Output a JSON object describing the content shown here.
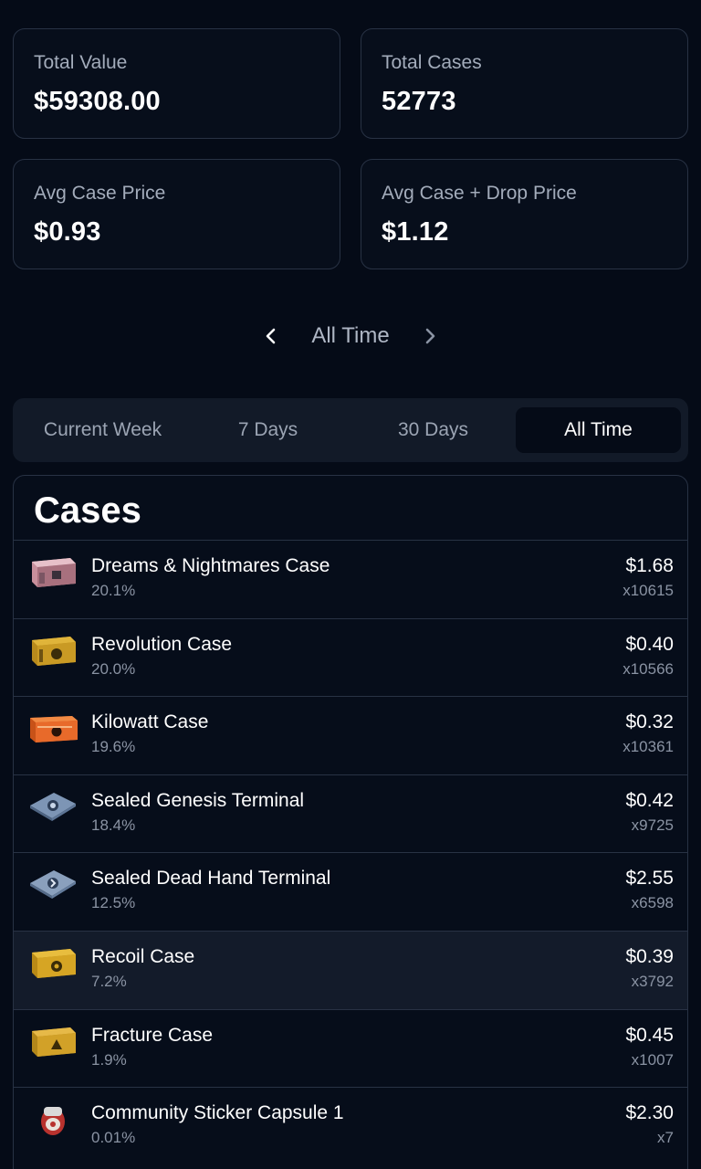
{
  "stats": {
    "total_value": {
      "label": "Total Value",
      "value": "$59308.00"
    },
    "total_cases": {
      "label": "Total Cases",
      "value": "52773"
    },
    "avg_case_price": {
      "label": "Avg Case Price",
      "value": "$0.93"
    },
    "avg_case_drop_price": {
      "label": "Avg Case + Drop Price",
      "value": "$1.12"
    }
  },
  "period_nav": {
    "label": "All Time",
    "prev_icon": "chevron-left-icon",
    "next_icon": "chevron-right-icon"
  },
  "range_tabs": [
    {
      "label": "Current Week",
      "active": false
    },
    {
      "label": "7 Days",
      "active": false
    },
    {
      "label": "30 Days",
      "active": false
    },
    {
      "label": "All Time",
      "active": true
    }
  ],
  "cases": {
    "title": "Cases",
    "items": [
      {
        "name": "Dreams & Nightmares Case",
        "pct": "20.1%",
        "price": "$1.68",
        "qty": "x10615",
        "icon": "dreams-nightmares-case-icon",
        "color": "#d9a7b3"
      },
      {
        "name": "Revolution Case",
        "pct": "20.0%",
        "price": "$0.40",
        "qty": "x10566",
        "icon": "revolution-case-icon",
        "color": "#c99a24"
      },
      {
        "name": "Kilowatt Case",
        "pct": "19.6%",
        "price": "$0.32",
        "qty": "x10361",
        "icon": "kilowatt-case-icon",
        "color": "#e86a2a"
      },
      {
        "name": "Sealed Genesis Terminal",
        "pct": "18.4%",
        "price": "$0.42",
        "qty": "x9725",
        "icon": "sealed-genesis-terminal-icon",
        "color": "#7d95b5"
      },
      {
        "name": "Sealed Dead Hand Terminal",
        "pct": "12.5%",
        "price": "$2.55",
        "qty": "x6598",
        "icon": "sealed-dead-hand-terminal-icon",
        "color": "#8aa0bd"
      },
      {
        "name": "Recoil Case",
        "pct": "7.2%",
        "price": "$0.39",
        "qty": "x3792",
        "icon": "recoil-case-icon",
        "color": "#d6a524"
      },
      {
        "name": "Fracture Case",
        "pct": "1.9%",
        "price": "$0.45",
        "qty": "x1007",
        "icon": "fracture-case-icon",
        "color": "#d2a128"
      },
      {
        "name": "Community Sticker Capsule 1",
        "pct": "0.01%",
        "price": "$2.30",
        "qty": "x7",
        "icon": "sticker-capsule-icon",
        "color": "#b8322e"
      }
    ]
  }
}
